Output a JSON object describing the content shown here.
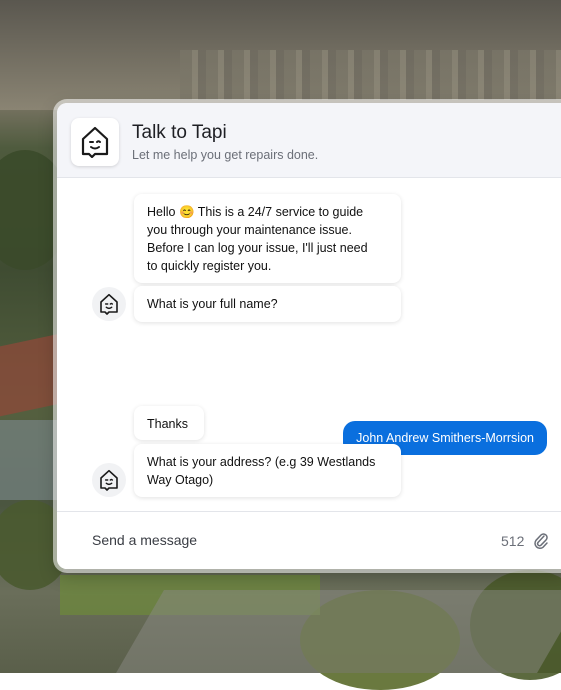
{
  "header": {
    "title": "Talk to Tapi",
    "subtitle": "Let me help you get repairs done."
  },
  "messages": {
    "greeting_line1": "Hello 😊 This is a 24/7 service to guide",
    "greeting_line2": "you through your maintenance issue.",
    "greeting_line3": "Before I can log your issue, I'll just need",
    "greeting_line4": "to quickly register you.",
    "ask_name": "What is your full name?",
    "user_reply": "John Andrew Smithers-Morrsion",
    "thanks": "Thanks",
    "ask_address_line1": "What is your address? (e.g 39 Westlands",
    "ask_address_line2": "Way Otago)"
  },
  "composer": {
    "placeholder": "Send a message",
    "char_count": "512"
  },
  "icons": {
    "bot_avatar": "house-face-icon",
    "attach": "paperclip-icon"
  },
  "colors": {
    "accent": "#0a6fde",
    "header_bg": "#f4f5f9"
  }
}
